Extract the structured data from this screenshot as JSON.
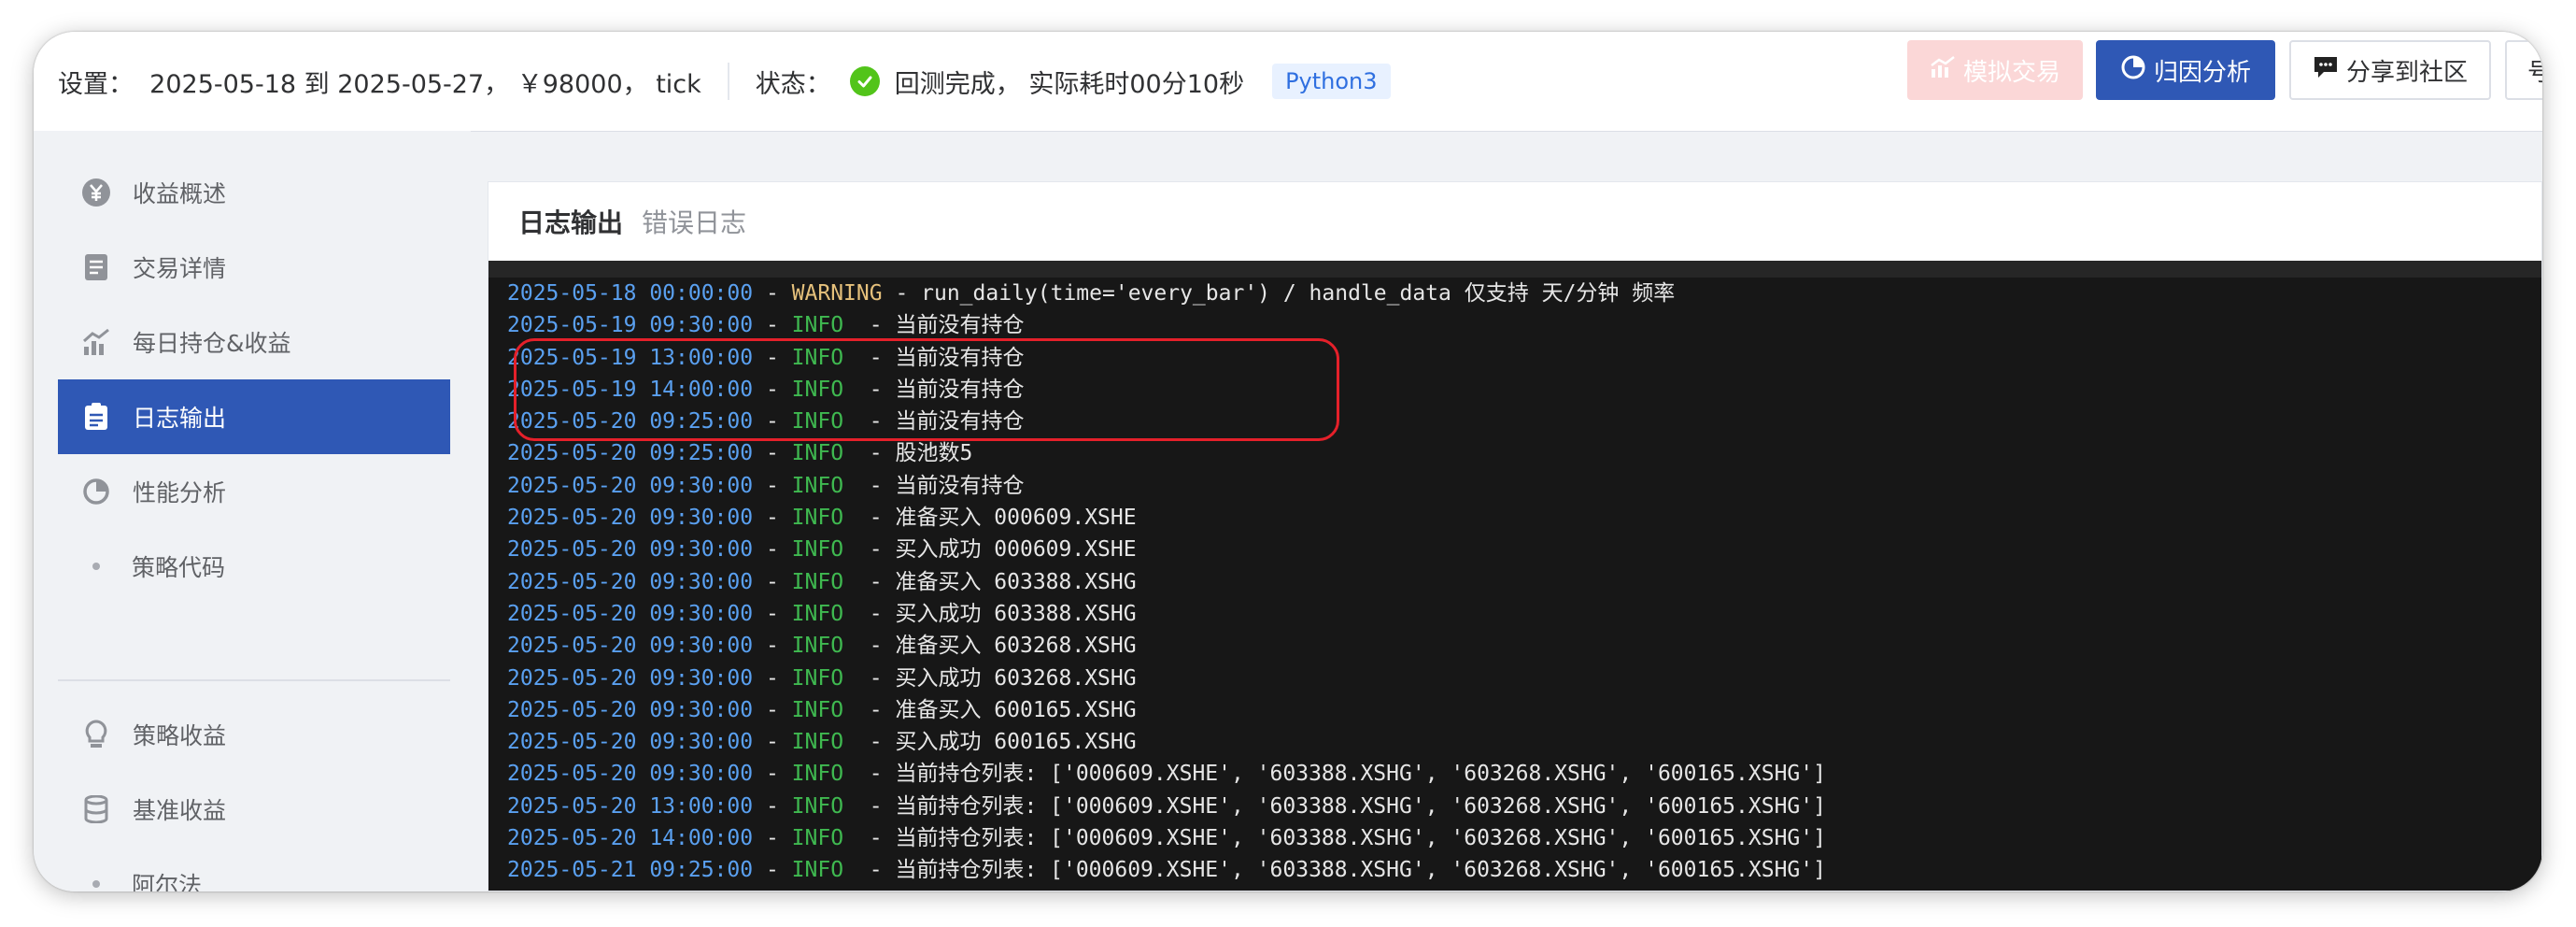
{
  "topbar": {
    "settings_text": "设置：  2025-05-18 到 2025-05-27， ￥98000， tick",
    "status_label": "状态：",
    "status_text": "回测完成， 实际耗时00分10秒",
    "language_badge": "Python3",
    "buttons": {
      "simulate": "模拟交易",
      "attribution": "归因分析",
      "share": "分享到社区",
      "more": "号"
    }
  },
  "sidebar": {
    "items": [
      {
        "label": "收益概述",
        "icon": "yen-circle-icon"
      },
      {
        "label": "交易详情",
        "icon": "document-icon"
      },
      {
        "label": "每日持仓&收益",
        "icon": "bar-chart-icon"
      },
      {
        "label": "日志输出",
        "icon": "clipboard-icon",
        "active": true
      },
      {
        "label": "性能分析",
        "icon": "pie-chart-icon"
      },
      {
        "label": "策略代码",
        "icon": "dot-icon"
      },
      {
        "label": "策略收益",
        "icon": "lightbulb-icon"
      },
      {
        "label": "基准收益",
        "icon": "database-icon"
      },
      {
        "label": "阿尔法",
        "icon": "dot-icon"
      }
    ]
  },
  "tabs": {
    "log_output": "日志输出",
    "error_log": "错误日志"
  },
  "colors": {
    "accent": "#2f58b5",
    "timestamp": "#5aa0f0",
    "info": "#3fb950",
    "warning": "#e5c07b",
    "highlight": "#e5202a"
  },
  "log": [
    {
      "time": "2025-05-18 00:00:00",
      "level": "WARNING",
      "msg": "run_daily(time='every_bar') / handle_data 仅支持 天/分钟 频率"
    },
    {
      "time": "2025-05-19 09:30:00",
      "level": "INFO",
      "msg": "当前没有持仓"
    },
    {
      "time": "2025-05-19 13:00:00",
      "level": "INFO",
      "msg": "当前没有持仓"
    },
    {
      "time": "2025-05-19 14:00:00",
      "level": "INFO",
      "msg": "当前没有持仓"
    },
    {
      "time": "2025-05-20 09:25:00",
      "level": "INFO",
      "msg": "当前没有持仓"
    },
    {
      "time": "2025-05-20 09:25:00",
      "level": "INFO",
      "msg": "股池数5"
    },
    {
      "time": "2025-05-20 09:30:00",
      "level": "INFO",
      "msg": "当前没有持仓"
    },
    {
      "time": "2025-05-20 09:30:00",
      "level": "INFO",
      "msg": "准备买入 000609.XSHE"
    },
    {
      "time": "2025-05-20 09:30:00",
      "level": "INFO",
      "msg": "买入成功 000609.XSHE"
    },
    {
      "time": "2025-05-20 09:30:00",
      "level": "INFO",
      "msg": "准备买入 603388.XSHG"
    },
    {
      "time": "2025-05-20 09:30:00",
      "level": "INFO",
      "msg": "买入成功 603388.XSHG"
    },
    {
      "time": "2025-05-20 09:30:00",
      "level": "INFO",
      "msg": "准备买入 603268.XSHG"
    },
    {
      "time": "2025-05-20 09:30:00",
      "level": "INFO",
      "msg": "买入成功 603268.XSHG"
    },
    {
      "time": "2025-05-20 09:30:00",
      "level": "INFO",
      "msg": "准备买入 600165.XSHG"
    },
    {
      "time": "2025-05-20 09:30:00",
      "level": "INFO",
      "msg": "买入成功 600165.XSHG"
    },
    {
      "time": "2025-05-20 09:30:00",
      "level": "INFO",
      "msg": "当前持仓列表: ['000609.XSHE', '603388.XSHG', '603268.XSHG', '600165.XSHG']"
    },
    {
      "time": "2025-05-20 13:00:00",
      "level": "INFO",
      "msg": "当前持仓列表: ['000609.XSHE', '603388.XSHG', '603268.XSHG', '600165.XSHG']"
    },
    {
      "time": "2025-05-20 14:00:00",
      "level": "INFO",
      "msg": "当前持仓列表: ['000609.XSHE', '603388.XSHG', '603268.XSHG', '600165.XSHG']"
    },
    {
      "time": "2025-05-21 09:25:00",
      "level": "INFO",
      "msg": "当前持仓列表: ['000609.XSHE', '603388.XSHG', '603268.XSHG', '600165.XSHG']"
    }
  ]
}
